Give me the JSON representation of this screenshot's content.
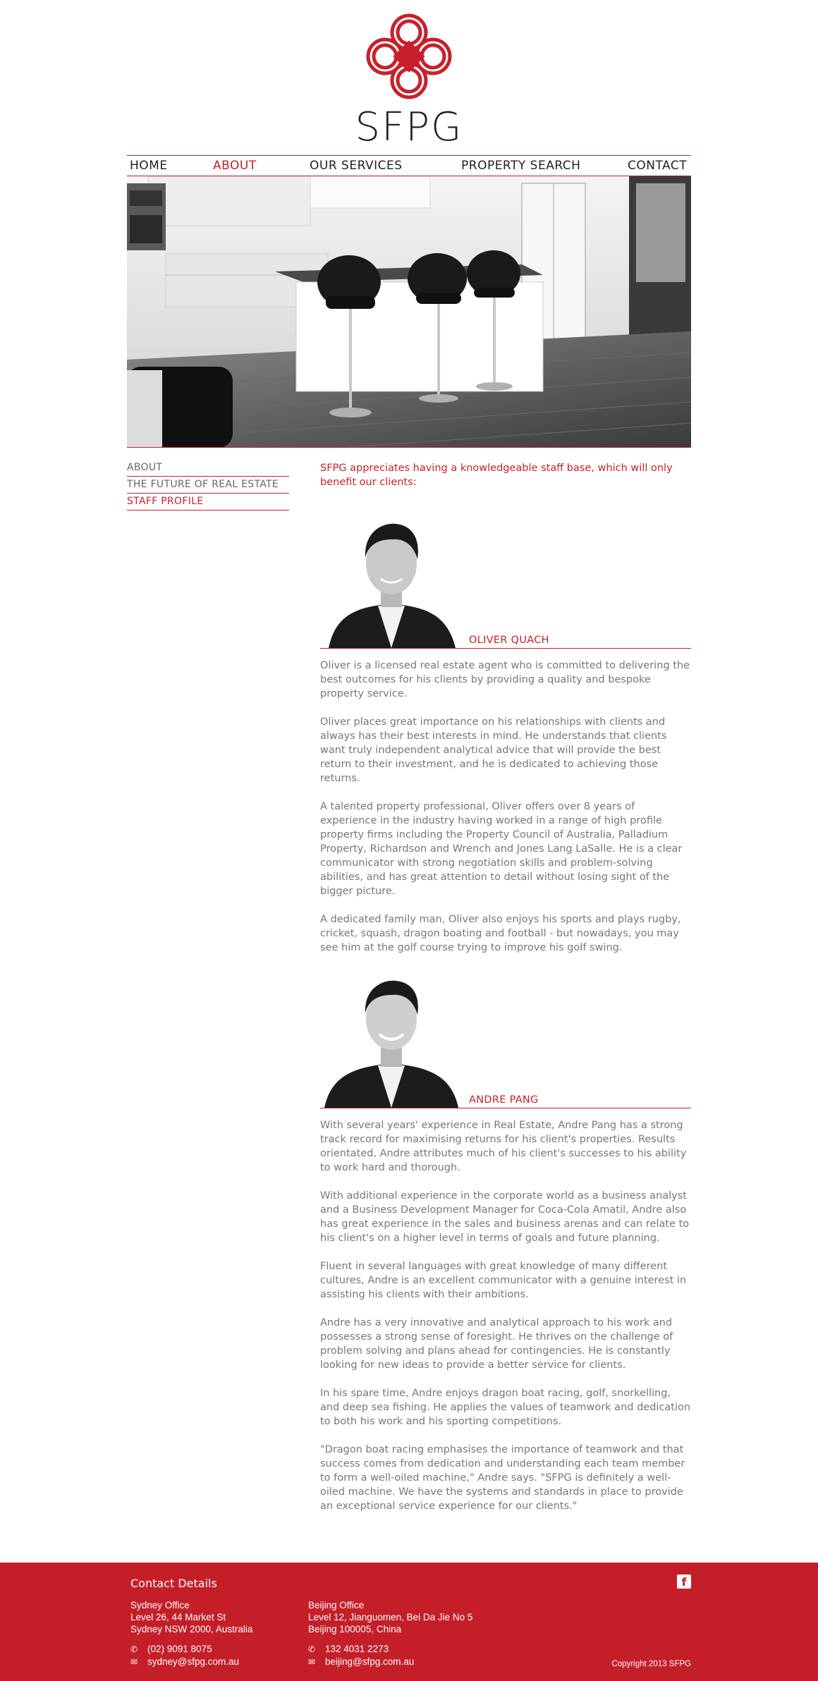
{
  "brand": {
    "name": "SFPG",
    "accent": "#c8202a"
  },
  "nav": {
    "items": [
      {
        "label": "HOME",
        "active": false
      },
      {
        "label": "ABOUT",
        "active": true
      },
      {
        "label": "OUR  SERVICES",
        "active": false
      },
      {
        "label": "PROPERTY SEARCH",
        "active": false
      },
      {
        "label": "CONTACT",
        "active": false
      }
    ]
  },
  "sidebar": {
    "items": [
      {
        "label": "ABOUT",
        "active": false
      },
      {
        "label": "THE FUTURE OF REAL ESTATE",
        "active": false
      },
      {
        "label": "STAFF PROFILE",
        "active": true
      }
    ]
  },
  "main": {
    "intro": "SFPG appreciates having a knowledgeable staff base, which will only benefit our clients:",
    "profiles": [
      {
        "name": "OLIVER QUACH",
        "bio": [
          "Oliver is a licensed real estate agent who is committed to delivering the best outcomes for his clients by providing a quality and bespoke property service.",
          "Oliver places great importance on his relationships with clients and always has their best interests in mind. He understands that clients want truly independent analytical advice that will provide the best return to their investment, and he is dedicated to achieving those returns.",
          "A talented property professional, Oliver offers over 8 years of experience in the industry having worked in a range of high profile property firms including the Property Council of Australia, Palladium Property, Richardson and Wrench and Jones Lang LaSalle. He is a clear communicator with strong negotiation skills and problem-solving abilities, and has great attention to detail without losing sight of the bigger picture.",
          "A dedicated family man, Oliver also enjoys his sports and plays rugby, cricket, squash, dragon boating and football - but nowadays, you may see him at the golf course trying to improve his golf swing."
        ]
      },
      {
        "name": "ANDRE PANG",
        "bio": [
          "With several years' experience in Real Estate, Andre Pang has a strong track record for maximising returns for his client's properties. Results orientated, Andre attributes much of his client's successes to his ability to work hard and thorough.",
          "With additional experience in the corporate world as a business analyst and a Business Development Manager for Coca-Cola Amatil, Andre also has great experience in the sales and business arenas and can relate to his client's on a higher level in terms of goals and future planning.",
          "Fluent in several languages with great knowledge of many different cultures, Andre is an excellent communicator with a genuine interest in assisting his clients with their ambitions.",
          "Andre has a very innovative and analytical approach to his work and possesses a strong sense of foresight. He thrives on the challenge of problem solving and plans ahead for contingencies. He is constantly looking for new ideas to provide a better service for clients.",
          "In his spare time, Andre enjoys dragon boat racing, golf, snorkelling, and deep sea fishing. He applies the values of teamwork and dedication to both his work and his sporting competitions.",
          "\"Dragon boat racing emphasises the importance of teamwork and that success comes from dedication and understanding each team member to form a well-oiled machine,\" Andre says. \"SFPG is definitely a well-oiled machine. We have the systems and standards in place to provide an exceptional service experience for our clients.\""
        ]
      }
    ]
  },
  "footer": {
    "title": "Contact Details",
    "sydney": {
      "lines": [
        "Sydney Office",
        "Level 26, 44 Market St",
        "Sydney NSW 2000, Australia"
      ],
      "phone": "(02) 9091 8075",
      "email": "sydney@sfpg.com.au"
    },
    "beijing": {
      "lines": [
        "Beijing Office",
        "Level 12, Jianguomen, Bei Da Jie No 5",
        "Beijing 100005, China"
      ],
      "phone": "132 4031 2273",
      "email": "beijing@sfpg.com.au"
    },
    "social": {
      "facebook_label": "f",
      "icon": "facebook-icon"
    },
    "copyright": "Copyright 2013  SFPG",
    "background": "#c41f29"
  }
}
